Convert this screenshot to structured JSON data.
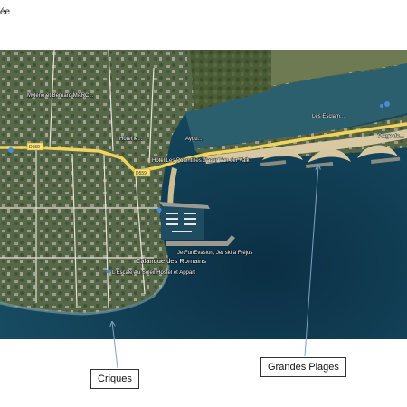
{
  "page": {
    "title_fragment": "ée"
  },
  "map": {
    "labels": {
      "mylene": "Mylène et Bernard MARC...",
      "hotel_left": "Hôtel le...",
      "cote_azur": "Hotel Les Potentilles d'azur Van der Valk",
      "ayguade": "Aygu...",
      "les_esclamandes": "Les Esclam...",
      "plage": "Plage de...",
      "calanque": "Calanque des Romains",
      "jetfun": "JetFunEvasion, Jet ski à Fréjus",
      "lescale": "L'Escale Au Soleil Hostel et Appart"
    },
    "roads": {
      "d559_left": "D559",
      "d559_right": "D559"
    },
    "colors": {
      "sea_deep": "#0f3a52",
      "sea_mid": "#1d5670",
      "shore": "#5e8a8c",
      "land": "#5c6b45",
      "sand": "#d8c9a4",
      "road": "#f3d35a"
    }
  },
  "callouts": {
    "criques": "Criques",
    "grandes_plages": "Grandes Plages"
  }
}
